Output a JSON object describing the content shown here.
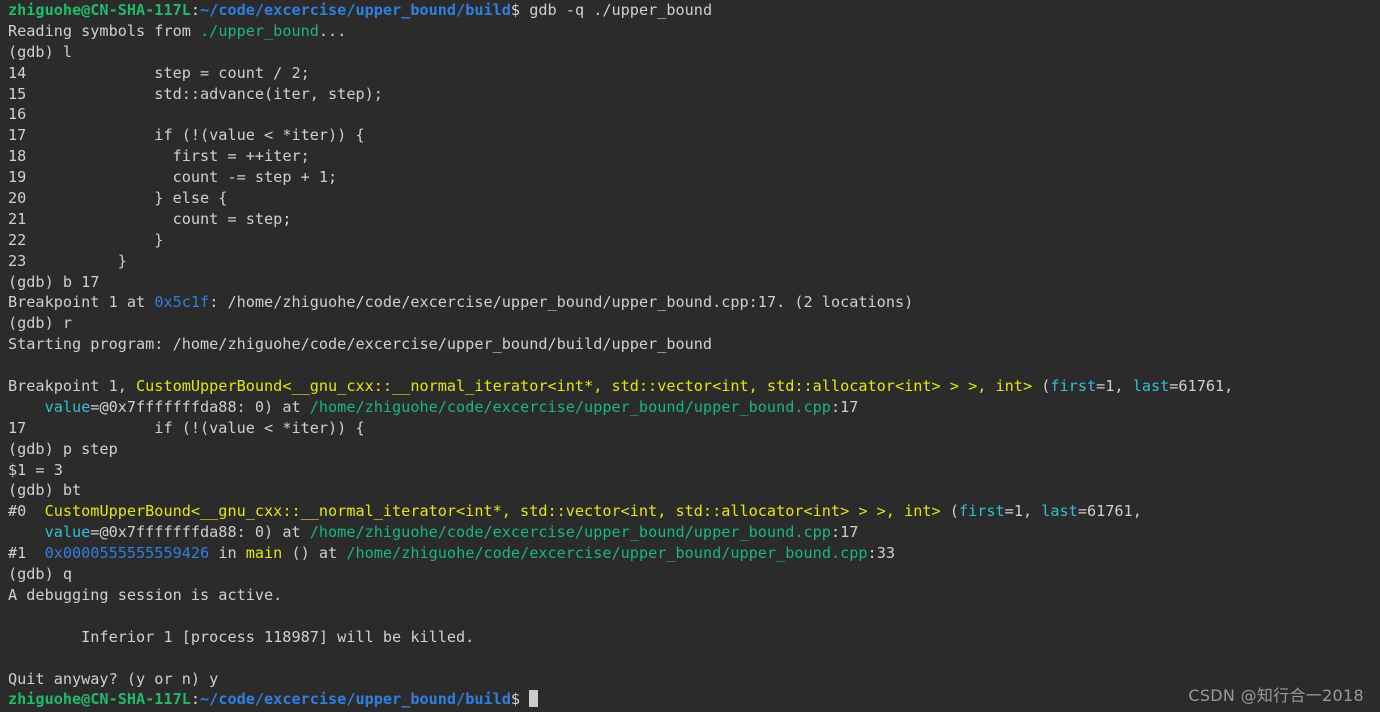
{
  "terminal": {
    "background": "#2b2b2b",
    "foreground": "#d0d0d0",
    "colors": {
      "user_host": "#1fbb6b",
      "path": "#2f7fe0",
      "file_green": "#18b87a",
      "function_yellow": "#e5e510",
      "param_cyan": "#2fc0d4",
      "address_blue": "#2f7fe0",
      "cursor": "#cccccc"
    }
  },
  "prompt": {
    "user_host": "zhiguohe@CN-SHA-117L",
    "separator": ":",
    "path": "~/code/excercise/upper_bound/build",
    "dollar": "$"
  },
  "lines": {
    "l01_command": " gdb -q ./upper_bound",
    "l02_a": "Reading symbols from ",
    "l02_b": "./upper_bound",
    "l02_c": "...",
    "l03": "(gdb) l",
    "l04": "14\t        step = count / 2;",
    "l05": "15\t        std::advance(iter, step);",
    "l06": "16",
    "l07": "17\t        if (!(value < *iter)) {",
    "l08": "18\t          first = ++iter;",
    "l09": "19\t          count -= step + 1;",
    "l10": "20\t        } else {",
    "l11": "21\t          count = step;",
    "l12": "22\t        }",
    "l13": "23\t    }",
    "l14": "(gdb) b 17",
    "l15_a": "Breakpoint 1 at ",
    "l15_b": "0x5c1f",
    "l15_c": ": /home/zhiguohe/code/excercise/upper_bound/upper_bound.cpp:17. (2 locations)",
    "l16": "(gdb) r",
    "l17": "Starting program: /home/zhiguohe/code/excercise/upper_bound/build/upper_bound",
    "l19_a": "Breakpoint 1, ",
    "l19_b": "CustomUpperBound<__gnu_cxx::__normal_iterator<int*, std::vector<int, std::allocator<int> > >, int>",
    "l19_c": " (",
    "l19_d": "first",
    "l19_e": "=1, ",
    "l19_f": "last",
    "l19_g": "=61761,",
    "l20_a": "    ",
    "l20_b": "value",
    "l20_c": "=@0x7fffffffda88: 0) at ",
    "l20_d": "/home/zhiguohe/code/excercise/upper_bound/upper_bound.cpp",
    "l20_e": ":17",
    "l21": "17\t        if (!(value < *iter)) {",
    "l22": "(gdb) p step",
    "l23": "$1 = 3",
    "l24": "(gdb) bt",
    "l25_a": "#0  ",
    "l25_b": "CustomUpperBound<__gnu_cxx::__normal_iterator<int*, std::vector<int, std::allocator<int> > >, int>",
    "l25_c": " (",
    "l25_d": "first",
    "l25_e": "=1, ",
    "l25_f": "last",
    "l25_g": "=61761,",
    "l26_a": "    ",
    "l26_b": "value",
    "l26_c": "=@0x7fffffffda88: 0) at ",
    "l26_d": "/home/zhiguohe/code/excercise/upper_bound/upper_bound.cpp",
    "l26_e": ":17",
    "l27_a": "#1  ",
    "l27_b": "0x0000555555559426",
    "l27_c": " in ",
    "l27_d": "main",
    "l27_e": " () at ",
    "l27_f": "/home/zhiguohe/code/excercise/upper_bound/upper_bound.cpp",
    "l27_g": ":33",
    "l28": "(gdb) q",
    "l29": "A debugging session is active.",
    "l31": "        Inferior 1 [process 118987] will be killed.",
    "l33": "Quit anyway? (y or n) y"
  },
  "watermark": "CSDN @知行合一2018"
}
